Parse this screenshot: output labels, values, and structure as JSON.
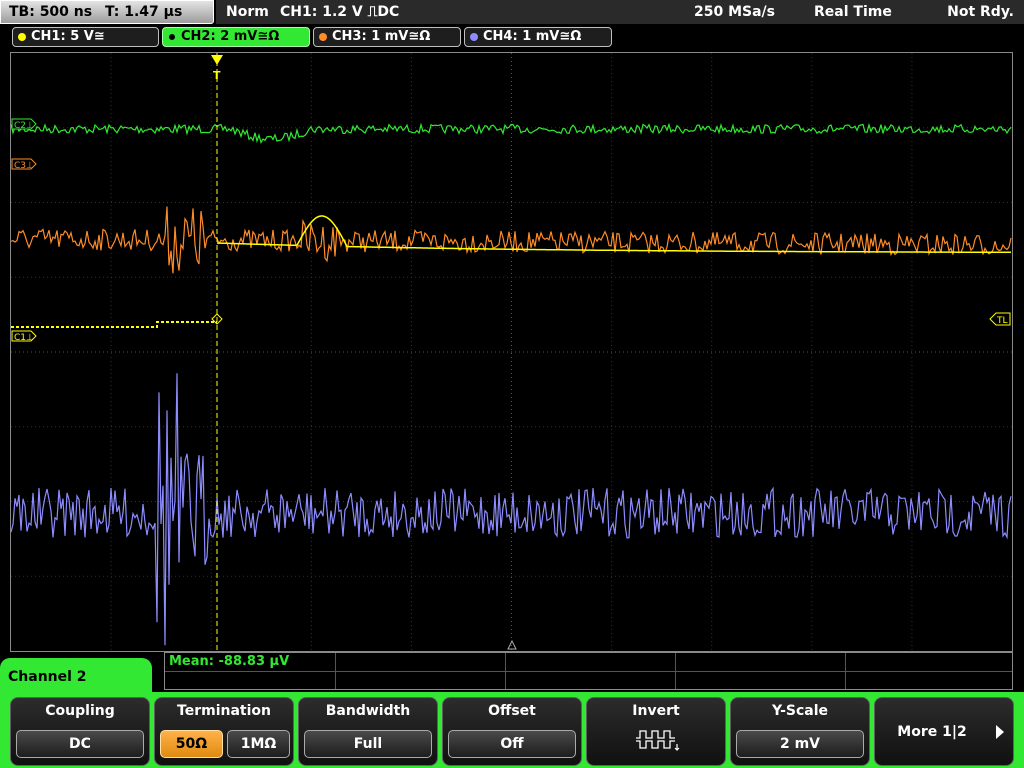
{
  "topbar": {
    "timebase": "TB: 500 ns",
    "trigger_time": "T: 1.47 µs",
    "mode": "Norm",
    "trigger": "CH1: 1.2 V ⎍DC",
    "sample_rate": "250 MSa/s",
    "acquisition": "Real Time",
    "ready": "Not Rdy."
  },
  "channels": [
    {
      "label": "CH1: 5 V≅",
      "color": "#ffff00",
      "active": false
    },
    {
      "label": "CH2: 2 mV≅Ω",
      "color": "#33e833",
      "active": true
    },
    {
      "label": "CH3: 1 mV≅Ω",
      "color": "#ff8c28",
      "active": false
    },
    {
      "label": "CH4: 1 mV≅Ω",
      "color": "#8c8cff",
      "active": false
    }
  ],
  "markers": {
    "c2": "C2⊥",
    "c3": "C3⊥",
    "c1": "C1⊥",
    "tl": "TL",
    "trigger_pos": "T"
  },
  "measurement": {
    "mean": "Mean: -88.83 µV"
  },
  "menu": {
    "title": "Channel 2",
    "coupling": {
      "label": "Coupling",
      "value": "DC"
    },
    "termination": {
      "label": "Termination",
      "options": [
        "50Ω",
        "1MΩ"
      ],
      "selected": "50Ω"
    },
    "bandwidth": {
      "label": "Bandwidth",
      "value": "Full"
    },
    "offset": {
      "label": "Offset",
      "value": "Off"
    },
    "invert": {
      "label": "Invert",
      "icon": "invert-waveform-icon"
    },
    "yscale": {
      "label": "Y-Scale",
      "value": "2 mV"
    },
    "more": {
      "label": "More 1|2",
      "icon": "arrow-right-icon"
    }
  },
  "colors": {
    "ch1": "#ffff00",
    "ch2": "#33e833",
    "ch3": "#ff8c28",
    "ch4": "#8c8cff",
    "menu_accent": "#33e833",
    "selected_button": "#f0a030"
  }
}
